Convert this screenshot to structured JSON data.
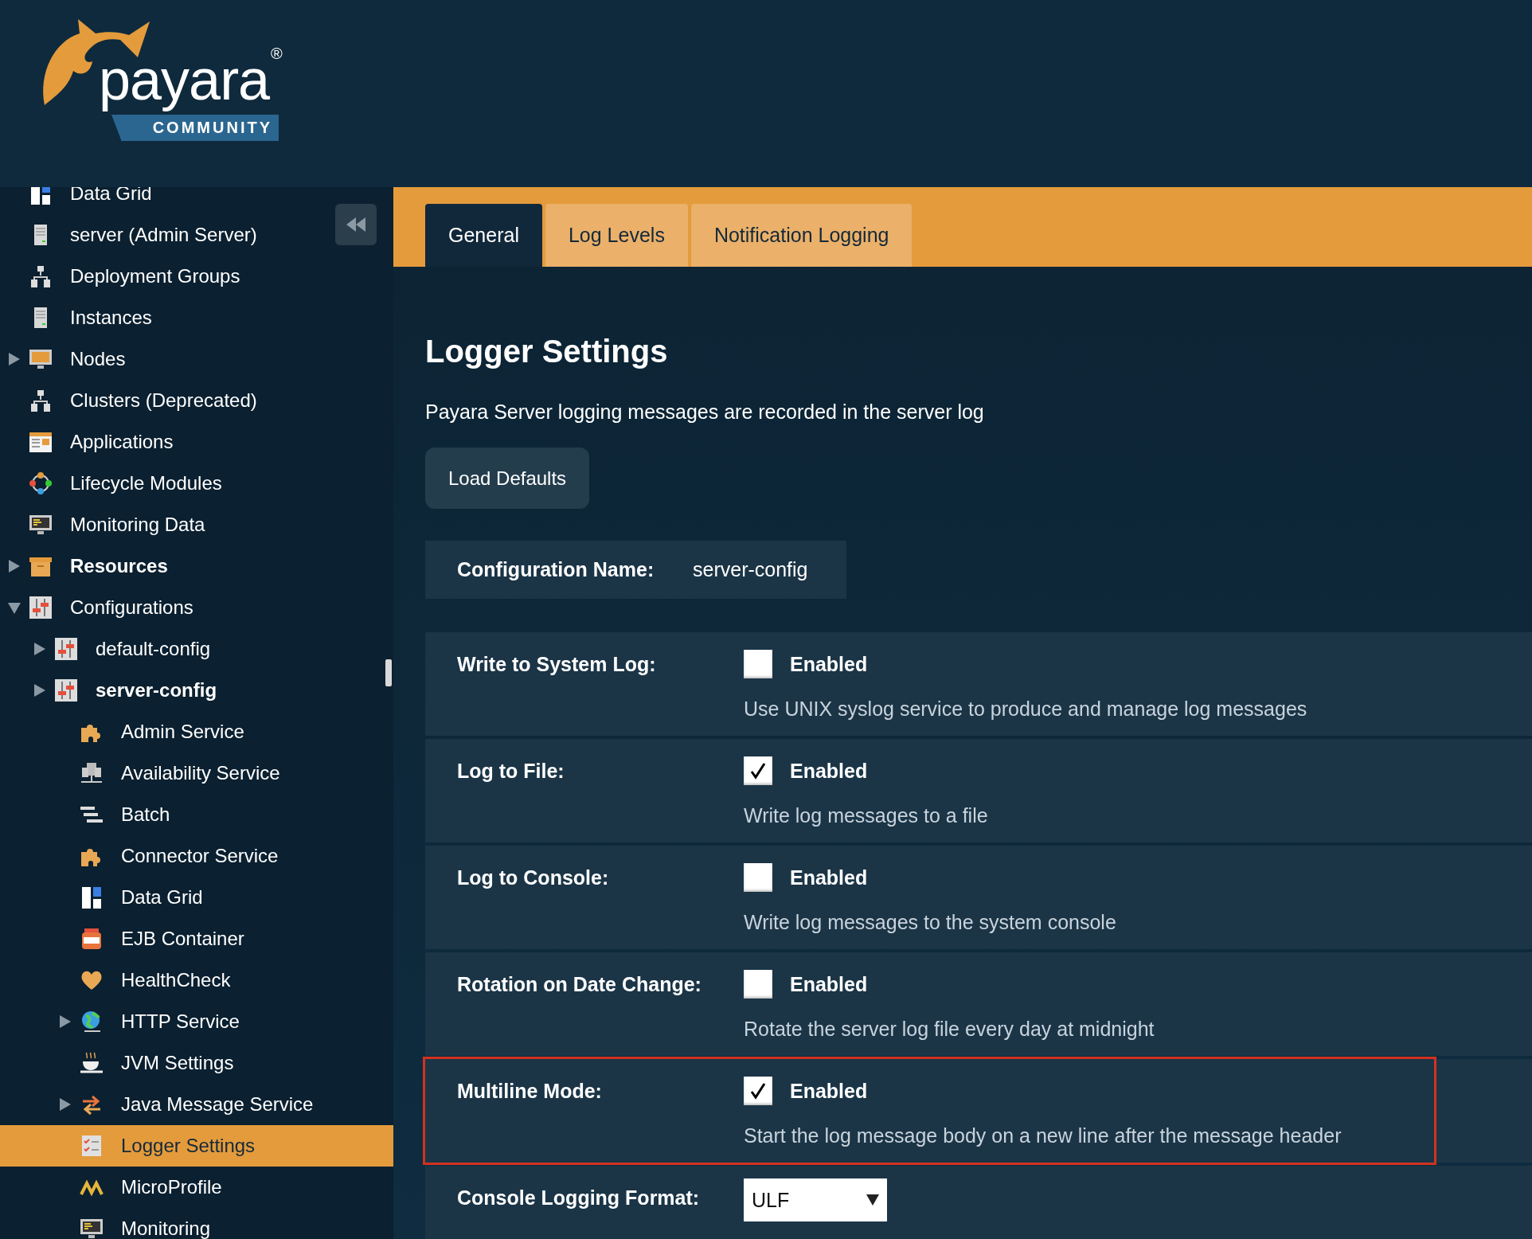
{
  "logo": {
    "wordmark": "payara",
    "registered": "®",
    "edition": "COMMUNITY"
  },
  "sidebar": {
    "items": [
      {
        "label": "Data Grid",
        "kind": "datagrid",
        "selected": false,
        "emphasized": false
      },
      {
        "label": "server (Admin Server)",
        "kind": "server",
        "selected": false,
        "emphasized": false
      },
      {
        "label": "Deployment Groups",
        "kind": "cluster",
        "selected": false,
        "emphasized": false
      },
      {
        "label": "Instances",
        "kind": "server",
        "selected": false,
        "emphasized": false
      },
      {
        "label": "Nodes",
        "kind": "monitor",
        "selected": false,
        "emphasized": false,
        "expanded": false
      },
      {
        "label": "Clusters (Deprecated)",
        "kind": "cluster",
        "selected": false,
        "emphasized": false
      },
      {
        "label": "Applications",
        "kind": "apps",
        "selected": false,
        "emphasized": false
      },
      {
        "label": "Lifecycle Modules",
        "kind": "lifecycle",
        "selected": false,
        "emphasized": false
      },
      {
        "label": "Monitoring Data",
        "kind": "screen",
        "selected": false,
        "emphasized": false
      },
      {
        "label": "Resources",
        "kind": "box",
        "selected": false,
        "emphasized": true,
        "expanded": false
      },
      {
        "label": "Configurations",
        "kind": "sliders",
        "selected": false,
        "emphasized": false,
        "expanded": true,
        "children": [
          {
            "label": "default-config",
            "kind": "sliders",
            "selected": false,
            "emphasized": false,
            "expanded": false
          },
          {
            "label": "server-config",
            "kind": "sliders",
            "selected": false,
            "emphasized": true,
            "expanded": false,
            "children": [
              {
                "label": "Admin Service",
                "kind": "puzzle",
                "selected": false,
                "emphasized": false
              },
              {
                "label": "Availability Service",
                "kind": "network",
                "selected": false,
                "emphasized": false
              },
              {
                "label": "Batch",
                "kind": "batch",
                "selected": false,
                "emphasized": false
              },
              {
                "label": "Connector Service",
                "kind": "puzzle",
                "selected": false,
                "emphasized": false
              },
              {
                "label": "Data Grid",
                "kind": "datagrid",
                "selected": false,
                "emphasized": false
              },
              {
                "label": "EJB Container",
                "kind": "jar",
                "selected": false,
                "emphasized": false
              },
              {
                "label": "HealthCheck",
                "kind": "heart",
                "selected": false,
                "emphasized": false
              },
              {
                "label": "HTTP Service",
                "kind": "globe",
                "selected": false,
                "emphasized": false,
                "expanded": false
              },
              {
                "label": "JVM Settings",
                "kind": "cup",
                "selected": false,
                "emphasized": false
              },
              {
                "label": "Java Message Service",
                "kind": "arrows",
                "selected": false,
                "emphasized": false,
                "expanded": false
              },
              {
                "label": "Logger Settings",
                "kind": "checklist",
                "selected": true,
                "emphasized": false
              },
              {
                "label": "MicroProfile",
                "kind": "micro",
                "selected": false,
                "emphasized": false
              },
              {
                "label": "Monitoring",
                "kind": "screen",
                "selected": false,
                "emphasized": false
              }
            ]
          }
        ]
      }
    ]
  },
  "tabs": [
    {
      "label": "General",
      "selected": true
    },
    {
      "label": "Log Levels",
      "selected": false
    },
    {
      "label": "Notification Logging",
      "selected": false
    }
  ],
  "page": {
    "title": "Logger Settings",
    "description": "Payara Server logging messages are recorded in the server log",
    "load_defaults": "Load Defaults",
    "configuration": {
      "label": "Configuration Name:",
      "value": "server-config"
    },
    "settings": [
      {
        "kind": "checkbox",
        "label": "Write to System Log:",
        "option": "Enabled",
        "checked": false,
        "description": "Use UNIX syslog service to produce and manage log messages",
        "highlighted": false
      },
      {
        "kind": "checkbox",
        "label": "Log to File:",
        "option": "Enabled",
        "checked": true,
        "description": "Write log messages to a file",
        "highlighted": false
      },
      {
        "kind": "checkbox",
        "label": "Log to Console:",
        "option": "Enabled",
        "checked": false,
        "description": "Write log messages to the system console",
        "highlighted": false
      },
      {
        "kind": "checkbox",
        "label": "Rotation on Date Change:",
        "option": "Enabled",
        "checked": false,
        "description": "Rotate the server log file every day at midnight",
        "highlighted": false
      },
      {
        "kind": "checkbox",
        "label": "Multiline Mode:",
        "option": "Enabled",
        "checked": true,
        "description": "Start the log message body on a new line after the message header",
        "highlighted": true
      },
      {
        "kind": "select",
        "label": "Console Logging Format:",
        "value": "ULF",
        "highlighted": false
      }
    ]
  }
}
